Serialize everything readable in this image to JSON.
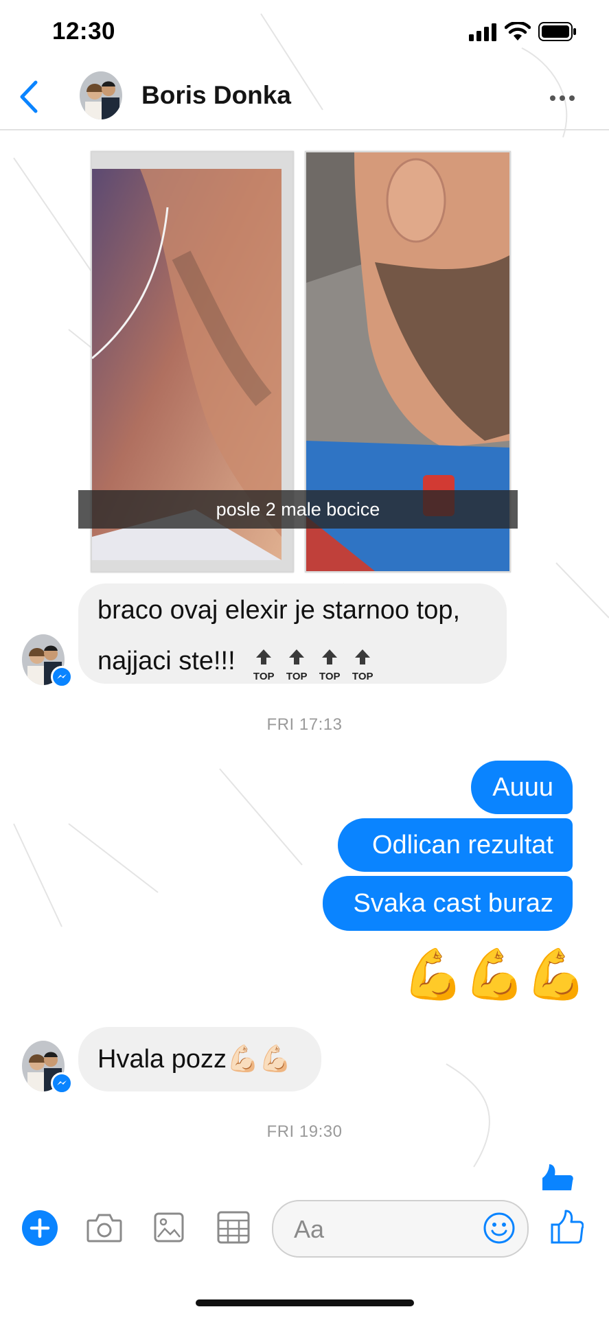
{
  "status_bar": {
    "time": "12:30"
  },
  "header": {
    "contact_name": "Boris Donka"
  },
  "photos": {
    "caption": "posle 2 male bocice"
  },
  "messages": {
    "incoming_1": {
      "line1": "braco ovaj elexir je starnoo top,",
      "line2": "najjaci ste!!!",
      "top_label": "TOP"
    },
    "timestamp_1": "FRI 17:13",
    "outgoing": [
      "Auuu",
      "Odlican rezultat",
      "Svaka cast buraz"
    ],
    "outgoing_emoji": "💪💪💪",
    "incoming_2": {
      "text": "Hvala pozz",
      "emoji": "💪🏻💪🏻"
    },
    "timestamp_2": "FRI 19:30"
  },
  "composer": {
    "placeholder": "Aa"
  },
  "colors": {
    "accent": "#0a84ff",
    "incoming_bubble": "#f0f0f0"
  }
}
